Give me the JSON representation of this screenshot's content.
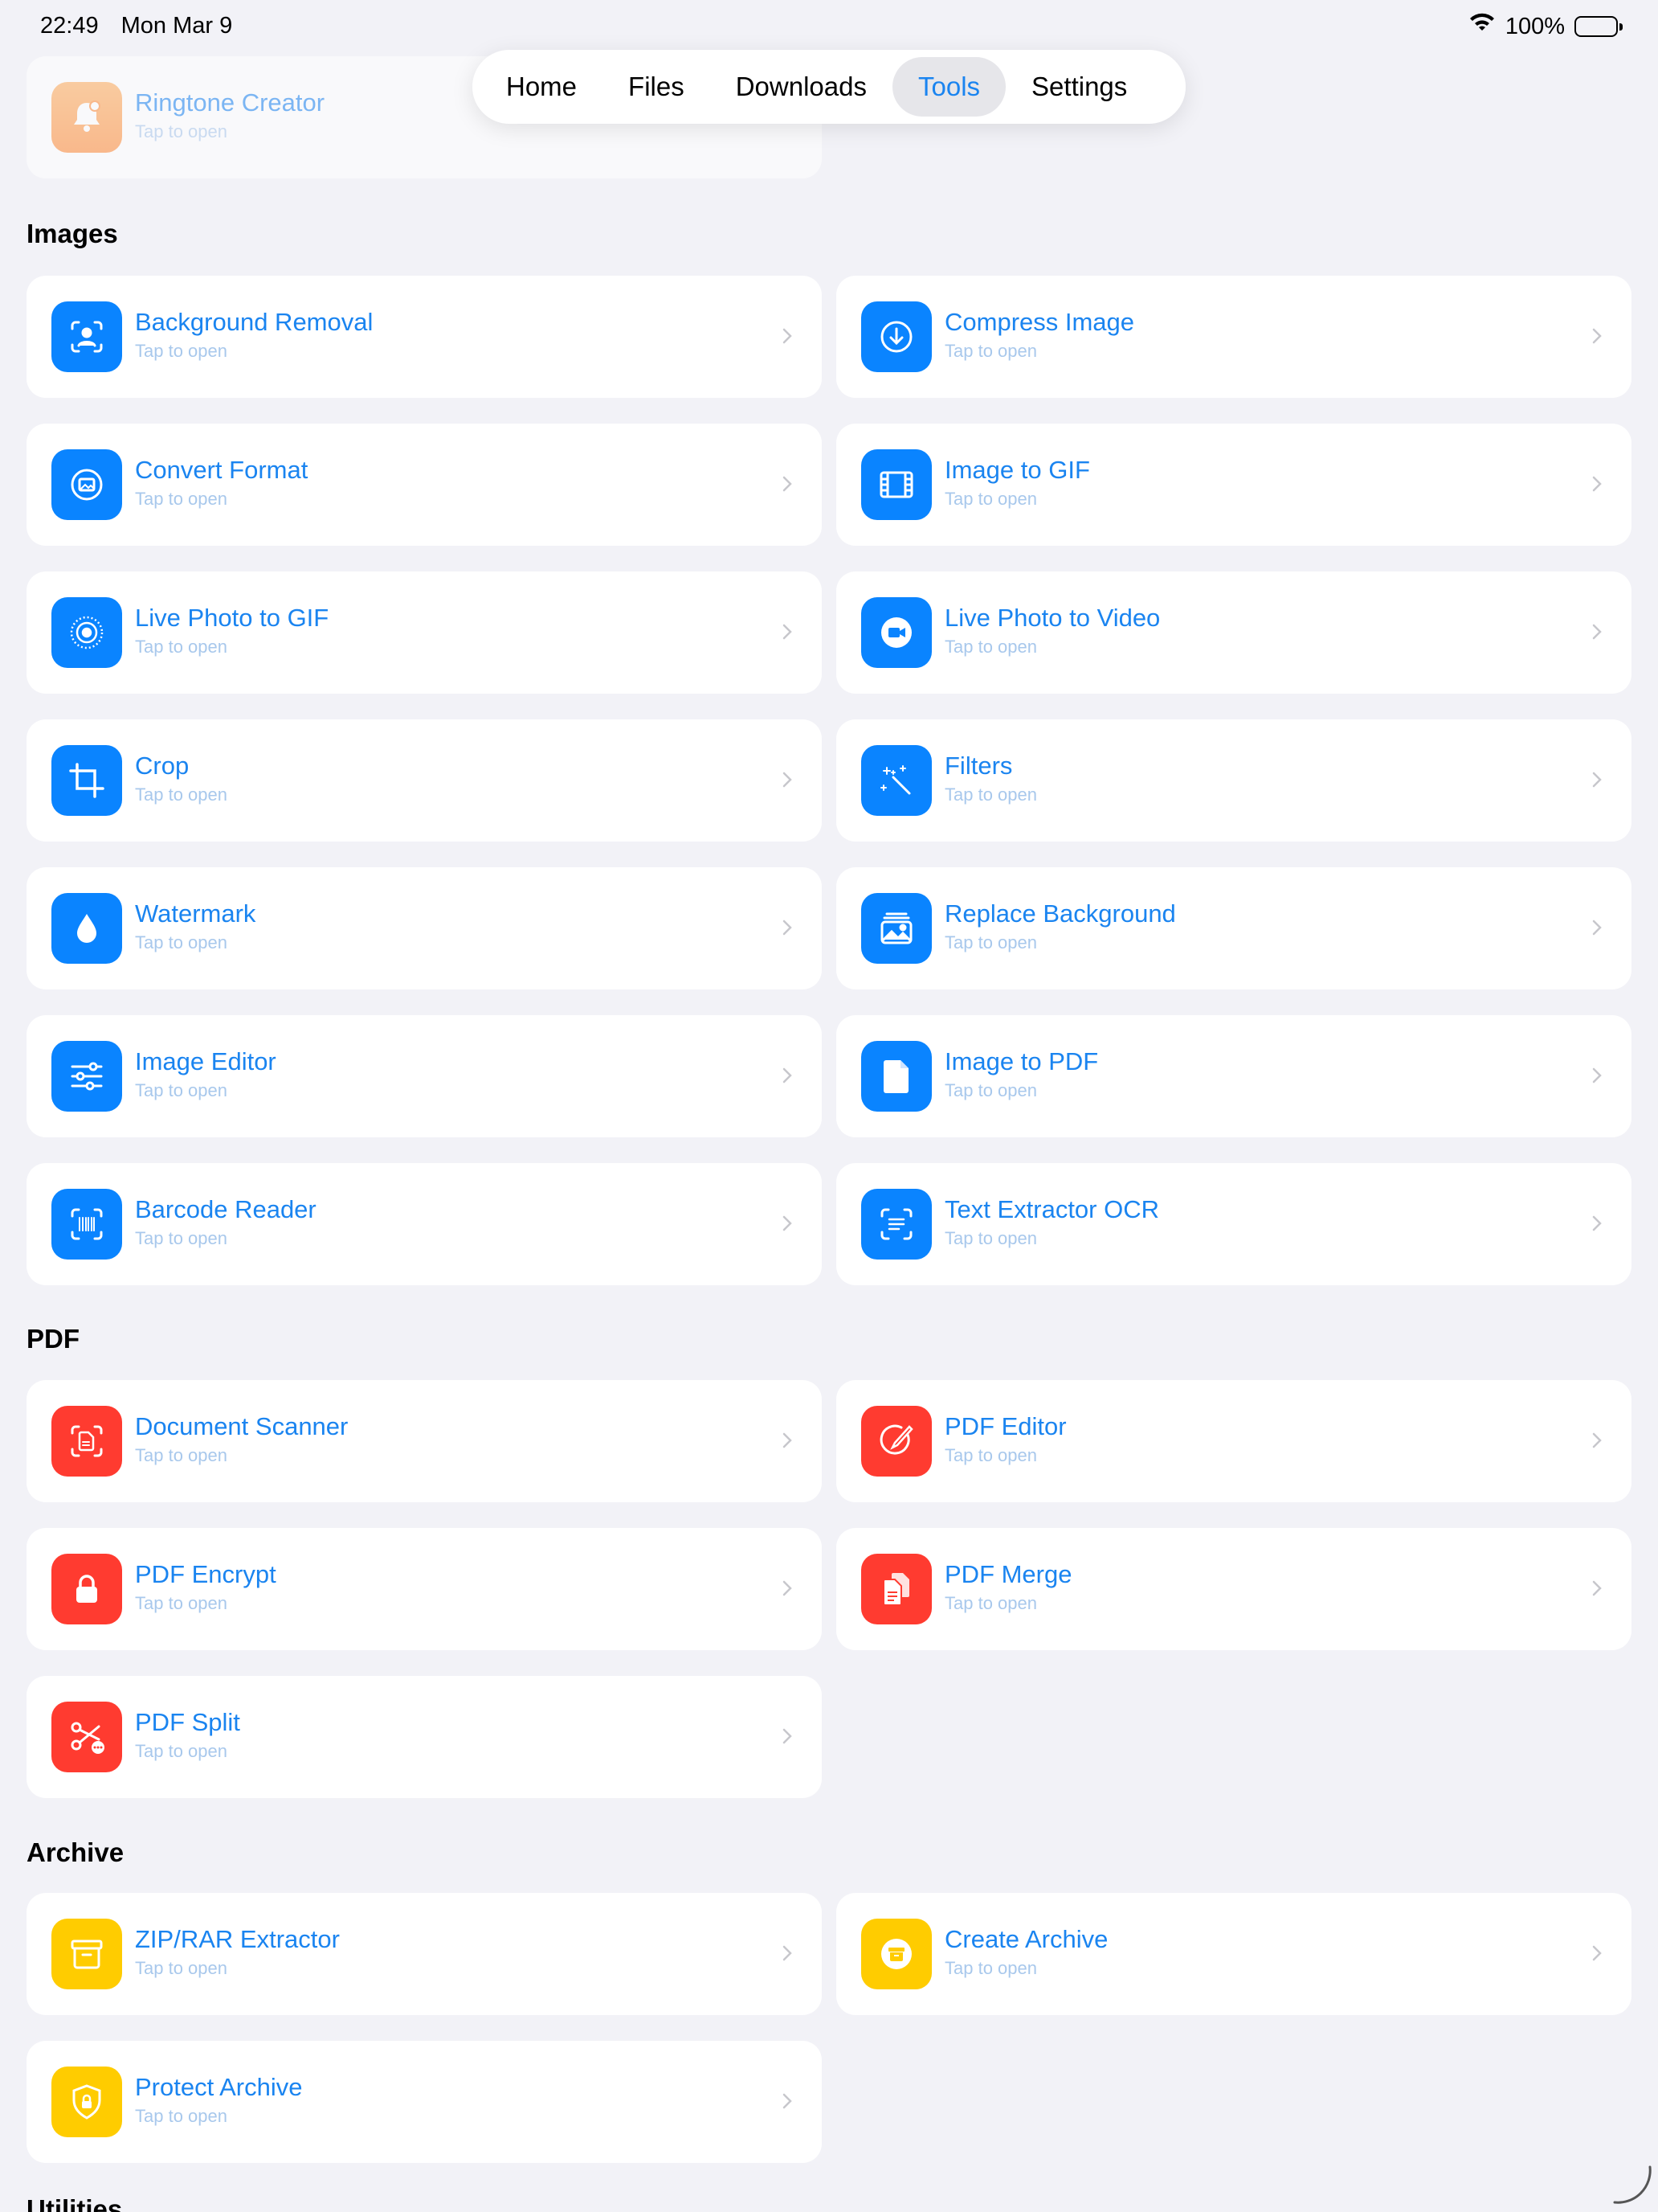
{
  "status_bar": {
    "time": "22:49",
    "date": "Mon Mar 9",
    "battery": "100%"
  },
  "tabs": [
    {
      "label": "Home",
      "active": false
    },
    {
      "label": "Files",
      "active": false
    },
    {
      "label": "Downloads",
      "active": false
    },
    {
      "label": "Tools",
      "active": true
    },
    {
      "label": "Settings",
      "active": false
    }
  ],
  "colors": {
    "accent": "#1a84f0",
    "images": "#0a84ff",
    "pdf": "#ff3b30",
    "archive": "#ffcc00",
    "audio": "#ff9a45"
  },
  "top_partial": {
    "title": "Ringtone Creator",
    "subtitle": "Tap to open",
    "icon": "bell-icon"
  },
  "sections": {
    "images": {
      "title": "Images",
      "items": [
        {
          "title": "Background Removal",
          "subtitle": "Tap to open",
          "icon": "person-viewfinder-icon"
        },
        {
          "title": "Compress Image",
          "subtitle": "Tap to open",
          "icon": "arrow-down-circle-icon"
        },
        {
          "title": "Convert Format",
          "subtitle": "Tap to open",
          "icon": "photo-circle-icon"
        },
        {
          "title": "Image to GIF",
          "subtitle": "Tap to open",
          "icon": "film-icon"
        },
        {
          "title": "Live Photo to GIF",
          "subtitle": "Tap to open",
          "icon": "live-photo-icon"
        },
        {
          "title": "Live Photo to Video",
          "subtitle": "Tap to open",
          "icon": "video-circle-icon"
        },
        {
          "title": "Crop",
          "subtitle": "Tap to open",
          "icon": "crop-icon"
        },
        {
          "title": "Filters",
          "subtitle": "Tap to open",
          "icon": "magic-wand-icon"
        },
        {
          "title": "Watermark",
          "subtitle": "Tap to open",
          "icon": "drop-icon"
        },
        {
          "title": "Replace Background",
          "subtitle": "Tap to open",
          "icon": "photo-stack-icon"
        },
        {
          "title": "Image Editor",
          "subtitle": "Tap to open",
          "icon": "sliders-icon"
        },
        {
          "title": "Image to PDF",
          "subtitle": "Tap to open",
          "icon": "document-icon"
        },
        {
          "title": "Barcode Reader",
          "subtitle": "Tap to open",
          "icon": "barcode-viewfinder-icon"
        },
        {
          "title": "Text Extractor OCR",
          "subtitle": "Tap to open",
          "icon": "text-viewfinder-icon"
        }
      ]
    },
    "pdf": {
      "title": "PDF",
      "items": [
        {
          "title": "Document Scanner",
          "subtitle": "Tap to open",
          "icon": "doc-viewfinder-icon"
        },
        {
          "title": "PDF Editor",
          "subtitle": "Tap to open",
          "icon": "pencil-circle-icon"
        },
        {
          "title": "PDF Encrypt",
          "subtitle": "Tap to open",
          "icon": "lock-icon"
        },
        {
          "title": "PDF Merge",
          "subtitle": "Tap to open",
          "icon": "docs-stack-icon"
        },
        {
          "title": "PDF Split",
          "subtitle": "Tap to open",
          "icon": "scissors-icon"
        }
      ]
    },
    "archive": {
      "title": "Archive",
      "items": [
        {
          "title": "ZIP/RAR Extractor",
          "subtitle": "Tap to open",
          "icon": "archive-box-icon"
        },
        {
          "title": "Create Archive",
          "subtitle": "Tap to open",
          "icon": "archive-circle-icon"
        },
        {
          "title": "Protect Archive",
          "subtitle": "Tap to open",
          "icon": "lock-shield-icon"
        }
      ]
    },
    "next_partial": {
      "title": "Utilities"
    }
  }
}
